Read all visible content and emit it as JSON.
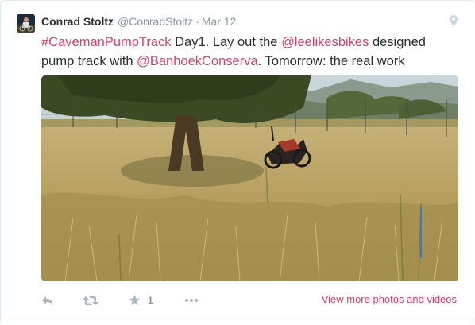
{
  "tweet": {
    "author_name": "Conrad Stoltz",
    "author_handle": "@ConradStoltz",
    "separator": "·",
    "timestamp": "Mar 12",
    "segments": [
      {
        "text": "#CavemanPumpTrack",
        "link": true
      },
      {
        "text": " Day1. Lay out the ",
        "link": false
      },
      {
        "text": "@leelikesbikes",
        "link": true
      },
      {
        "text": " designed pump track with ",
        "link": false
      },
      {
        "text": "@BanhoekConserva",
        "link": true
      },
      {
        "text": ". Tomorrow: the real work",
        "link": false
      }
    ]
  },
  "actions": {
    "favorite_count": "1",
    "view_more_label": "View more photos and videos"
  },
  "icons": {
    "location": "location-pin-icon",
    "reply": "reply-icon",
    "retweet": "retweet-icon",
    "favorite": "star-icon",
    "more": "more-dots-icon"
  },
  "colors": {
    "link": "#d4416b",
    "text": "#292f33",
    "muted": "#8899a6",
    "icon": "#aab8c2"
  }
}
